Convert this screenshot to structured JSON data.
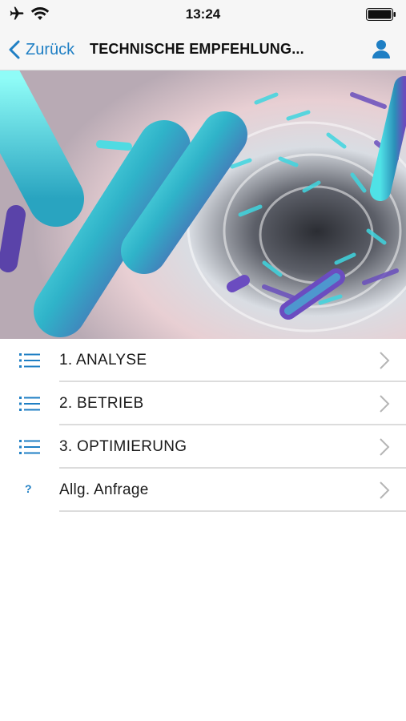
{
  "status_bar": {
    "time": "13:24",
    "icons": [
      "airplane-icon",
      "wifi-icon",
      "battery-icon"
    ]
  },
  "nav_bar": {
    "back_label": "Zurück",
    "title": "TECHNISCHE EMPFEHLUNG...",
    "profile_icon": "user-icon"
  },
  "hero": {
    "icon": "bacteria-illustration"
  },
  "menu": {
    "items": [
      {
        "label": "1. ANALYSE",
        "icon": "list-icon"
      },
      {
        "label": "2. BETRIEB",
        "icon": "list-icon"
      },
      {
        "label": "3. OPTIMIERUNG",
        "icon": "list-icon"
      },
      {
        "label": "Allg. Anfrage",
        "icon": "question-icon",
        "icon_text": "?"
      }
    ]
  },
  "colors": {
    "accent": "#1f7fc4",
    "bar_background": "#f6f6f6",
    "divider": "#dcdcdc",
    "chevron": "#b5b5b5"
  }
}
